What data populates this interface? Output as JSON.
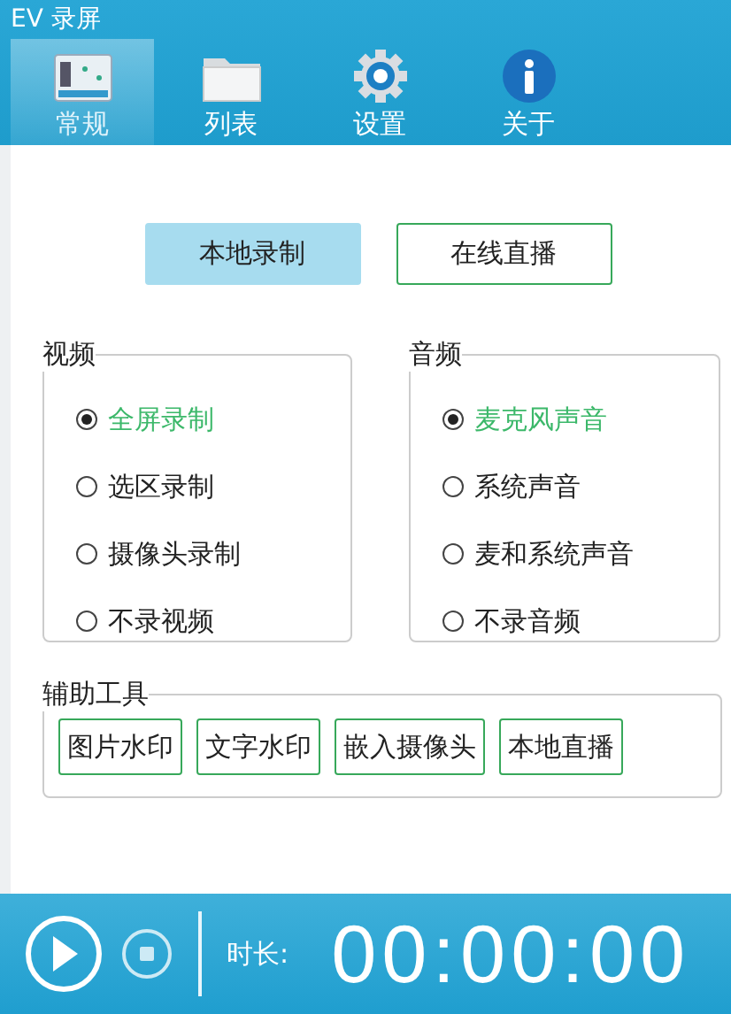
{
  "window": {
    "title": "EV 录屏"
  },
  "tabs": [
    {
      "label": "常规",
      "kind": "general",
      "selected": true
    },
    {
      "label": "列表",
      "kind": "list",
      "selected": false
    },
    {
      "label": "设置",
      "kind": "settings",
      "selected": false
    },
    {
      "label": "关于",
      "kind": "about",
      "selected": false
    }
  ],
  "modes": [
    {
      "label": "本地录制",
      "selected": true
    },
    {
      "label": "在线直播",
      "selected": false
    }
  ],
  "groups": [
    {
      "title": "视频",
      "options": [
        {
          "label": "全屏录制",
          "selected": true
        },
        {
          "label": "选区录制",
          "selected": false
        },
        {
          "label": "摄像头录制",
          "selected": false
        },
        {
          "label": "不录视频",
          "selected": false
        }
      ]
    },
    {
      "title": "音频",
      "options": [
        {
          "label": "麦克风声音",
          "selected": true
        },
        {
          "label": "系统声音",
          "selected": false
        },
        {
          "label": "麦和系统声音",
          "selected": false
        },
        {
          "label": "不录音频",
          "selected": false
        }
      ]
    }
  ],
  "tools": {
    "title": "辅助工具",
    "buttons": [
      "图片水印",
      "文字水印",
      "嵌入摄像头",
      "本地直播"
    ]
  },
  "player": {
    "duration_label": "时长:",
    "timer": [
      "00",
      ":",
      "00",
      ":",
      "00"
    ]
  }
}
